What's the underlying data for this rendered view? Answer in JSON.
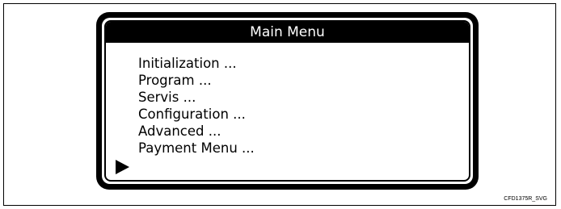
{
  "screen": {
    "title": "Main Menu",
    "items": [
      {
        "label": "Initialization ..."
      },
      {
        "label": "Program ..."
      },
      {
        "label": "Servis ..."
      },
      {
        "label": "Configuration ..."
      },
      {
        "label": "Advanced ..."
      },
      {
        "label": "Payment Menu ..."
      }
    ],
    "selected_index": 5,
    "cursor_icon": "triangle-right-icon"
  },
  "figure_code": "CFD1375R_SVG"
}
